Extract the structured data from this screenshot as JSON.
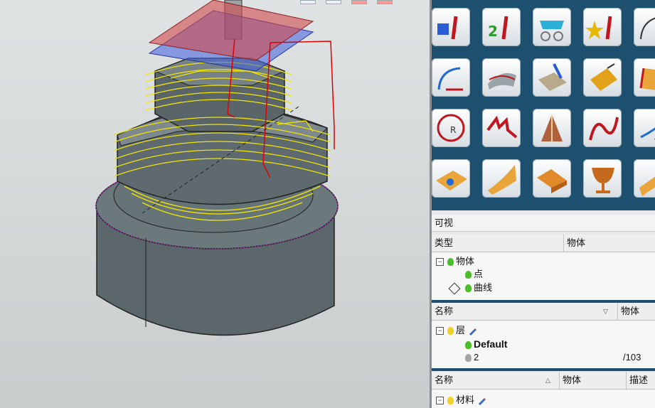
{
  "palette": {
    "tiles": [
      {
        "icon": "cube-info-icon"
      },
      {
        "icon": "two-info-icon"
      },
      {
        "icon": "glasses-check-icon"
      },
      {
        "icon": "star-info-icon"
      },
      {
        "icon": "measure-info-icon"
      },
      {
        "icon": "curve-offset-icon"
      },
      {
        "icon": "surface-curve-icon"
      },
      {
        "icon": "surface-pencil-icon"
      },
      {
        "icon": "surface-flip-icon"
      },
      {
        "icon": "surface-edge-icon"
      },
      {
        "icon": "circle-radius-icon"
      },
      {
        "icon": "zigzag-curve-icon"
      },
      {
        "icon": "cone-surface-icon"
      },
      {
        "icon": "spline-icon"
      },
      {
        "icon": "extend-curve-icon"
      },
      {
        "icon": "flat-surface-icon"
      },
      {
        "icon": "curved-sheet-icon"
      },
      {
        "icon": "folded-sheet-icon"
      },
      {
        "icon": "goblet-icon"
      },
      {
        "icon": "swept-sheet-icon"
      }
    ]
  },
  "visibility_panel": {
    "title": "可视",
    "columns": [
      "类型",
      "物体"
    ],
    "rows": [
      {
        "label": "物体"
      },
      {
        "label": "点"
      },
      {
        "label": "曲线"
      }
    ]
  },
  "layers_panel": {
    "columns": [
      "名称",
      "物体"
    ],
    "rows": [
      {
        "label": "层",
        "value": ""
      },
      {
        "label": "Default",
        "value": ""
      },
      {
        "label": "2",
        "value": "/103"
      }
    ]
  },
  "materials_panel": {
    "columns": [
      "名称",
      "物体",
      "描述"
    ],
    "rows": [
      {
        "label": "材料"
      }
    ]
  },
  "colors": {
    "palette_bg": "#1d4f6f",
    "toolpath": "#f2e600",
    "model": "#59666b",
    "plane_red": "#d24a4a",
    "plane_blue": "#3f5fe0",
    "path_red": "#e00000"
  }
}
